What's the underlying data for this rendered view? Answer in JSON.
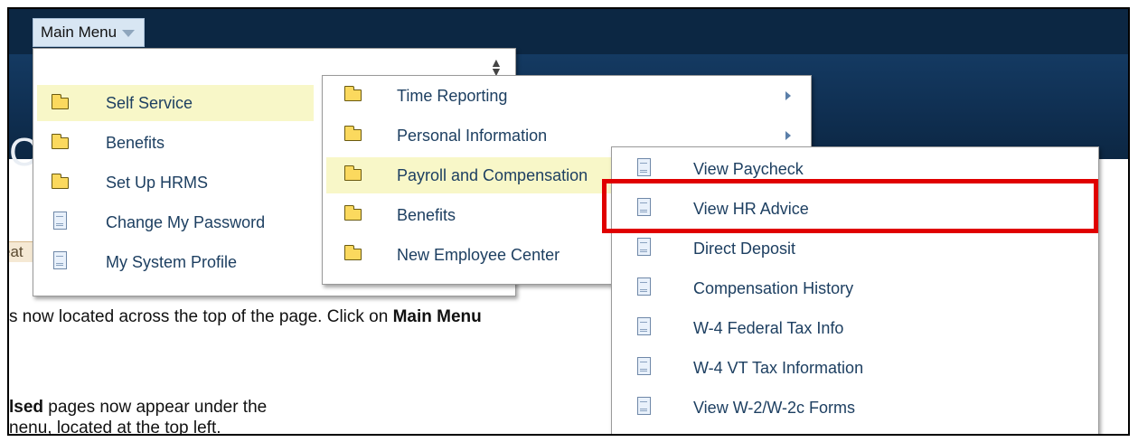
{
  "header": {
    "main_menu_label": "Main Menu",
    "banner_fragment": "C"
  },
  "page": {
    "tab_fragment": "eat",
    "line1_pre": "s now located across the top of the page. Click on ",
    "line1_bold": "Main Menu",
    "line2_bold": "lsed",
    "line2_rest": " pages now appear under the",
    "line3": "nenu, located at the top left."
  },
  "menu_level1": {
    "items": [
      {
        "label": "Self Service",
        "icon": "folder-icon",
        "highlighted": true
      },
      {
        "label": "Benefits",
        "icon": "folder-icon"
      },
      {
        "label": "Set Up HRMS",
        "icon": "folder-icon"
      },
      {
        "label": "Change My Password",
        "icon": "page-icon"
      },
      {
        "label": "My System Profile",
        "icon": "page-icon"
      }
    ]
  },
  "menu_level2": {
    "items": [
      {
        "label": "Time Reporting",
        "icon": "folder-icon",
        "has_submenu": true
      },
      {
        "label": "Personal Information",
        "icon": "folder-icon",
        "has_submenu": true
      },
      {
        "label": "Payroll and Compensation",
        "icon": "folder-icon",
        "highlighted": true
      },
      {
        "label": "Benefits",
        "icon": "folder-icon"
      },
      {
        "label": "New Employee Center",
        "icon": "folder-icon"
      }
    ]
  },
  "menu_level3": {
    "items": [
      {
        "label": "View Paycheck",
        "icon": "page-icon"
      },
      {
        "label": "View HR Advice",
        "icon": "page-icon",
        "annotated": true
      },
      {
        "label": "Direct Deposit",
        "icon": "page-icon"
      },
      {
        "label": "Compensation History",
        "icon": "page-icon"
      },
      {
        "label": "W-4 Federal Tax Info",
        "icon": "page-icon"
      },
      {
        "label": "W-4 VT Tax Information",
        "icon": "page-icon"
      },
      {
        "label": "View W-2/W-2c Forms",
        "icon": "page-icon"
      }
    ]
  },
  "colors": {
    "header_bg": "#0c2743",
    "highlight": "#f8f7c8",
    "link_text": "#1d3f61",
    "annotation": "#e00000"
  }
}
